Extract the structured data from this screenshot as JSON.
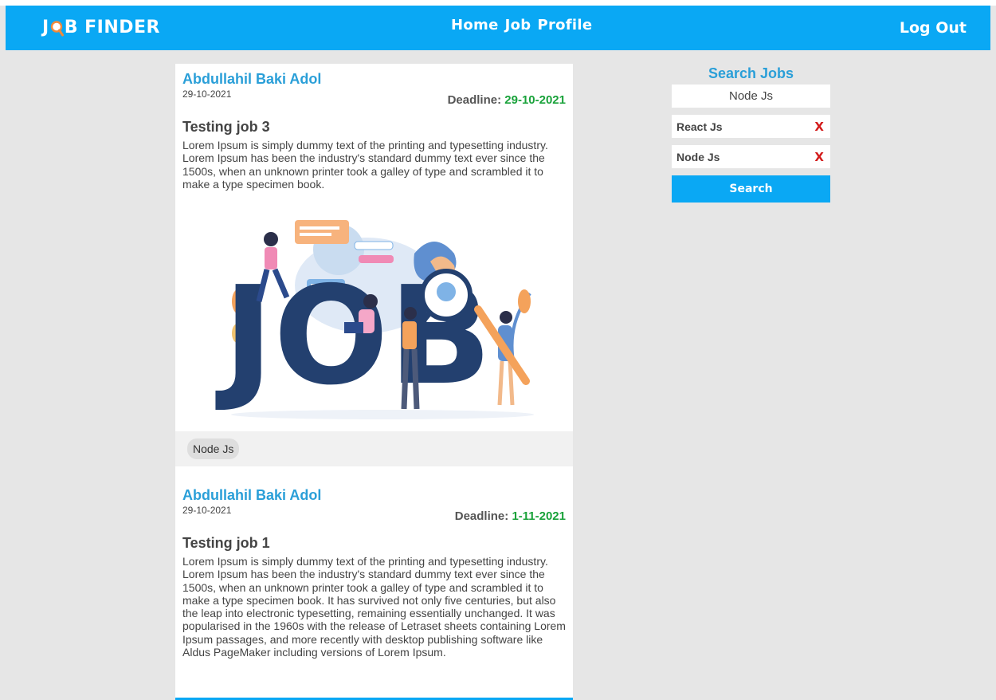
{
  "navbar": {
    "logo_pre": "J",
    "logo_post": "B FINDER",
    "links": [
      "Home",
      "Job",
      "Profile"
    ],
    "logout": "Log Out"
  },
  "jobs": [
    {
      "author": "Abdullahil Baki Adol",
      "posted": "29-10-2021",
      "deadline_label": "Deadline:",
      "deadline": "29-10-2021",
      "title": "Testing job 3",
      "description": "Lorem Ipsum is simply dummy text of the printing and typesetting industry. Lorem Ipsum has been the industry's standard dummy text ever since the 1500s, when an unknown printer took a galley of type and scrambled it to make a type specimen book.",
      "image_text": "JOB",
      "tags": [
        "Node Js"
      ]
    },
    {
      "author": "Abdullahil Baki Adol",
      "posted": "29-10-2021",
      "deadline_label": "Deadline:",
      "deadline": "1-11-2021",
      "title": "Testing job 1",
      "description": "Lorem Ipsum is simply dummy text of the printing and typesetting industry. Lorem Ipsum has been the industry's standard dummy text ever since the 1500s, when an unknown printer took a galley of type and scrambled it to make a type specimen book. It has survived not only five centuries, but also the leap into electronic typesetting, remaining essentially unchanged. It was popularised in the 1960s with the release of Letraset sheets containing Lorem Ipsum passages, and more recently with desktop publishing software like Aldus PageMaker including versions of Lorem Ipsum."
    }
  ],
  "search": {
    "title": "Search Jobs",
    "input_value": "Node Js",
    "selected": [
      "React Js",
      "Node Js"
    ],
    "remove_symbol": "X",
    "button": "Search"
  },
  "colors": {
    "brand": "#0aa8f4",
    "author": "#2a9fd8",
    "deadline_date": "#19a23a",
    "remove": "#d31b1b",
    "background": "#e6e6e6"
  }
}
